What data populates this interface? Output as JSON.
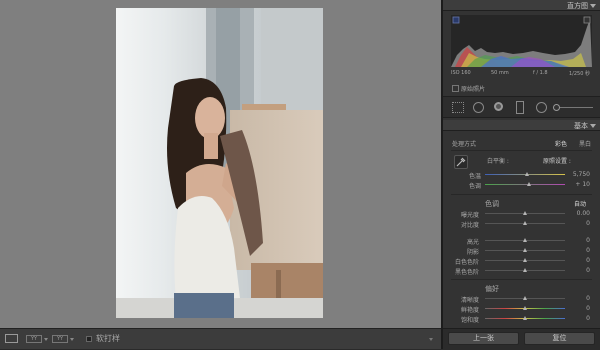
{
  "histogram": {
    "title": "直方图",
    "exif": {
      "iso": "ISO 160",
      "focal": "50 mm",
      "aperture": "f / 1.8",
      "shutter": "1/250 秒"
    },
    "original_photo_label": "原始照片"
  },
  "basic": {
    "title": "基本",
    "treatment_label": "处理方式",
    "treatment_color": "彩色",
    "treatment_bw": "黑白",
    "wb_label": "白平衡 :",
    "wb_value": "原照设置 :",
    "temp": {
      "label": "色温",
      "value": "5,750",
      "level": 0.52
    },
    "tint": {
      "label": "色调",
      "value": "+ 10",
      "level": 0.55
    },
    "tone_title": "色调",
    "auto_label": "自动",
    "exposure": {
      "label": "曝光度",
      "value": "0.00",
      "level": 0.5
    },
    "contrast": {
      "label": "对比度",
      "value": "0",
      "level": 0.5
    },
    "highlights": {
      "label": "高光",
      "value": "0",
      "level": 0.5
    },
    "shadows": {
      "label": "阴影",
      "value": "0",
      "level": 0.5
    },
    "whites": {
      "label": "白色色阶",
      "value": "0",
      "level": 0.5
    },
    "blacks": {
      "label": "黑色色阶",
      "value": "0",
      "level": 0.5
    },
    "presence_title": "偏好",
    "clarity": {
      "label": "清晰度",
      "value": "0",
      "level": 0.5
    },
    "vibrance": {
      "label": "鲜艳度",
      "value": "0",
      "level": 0.5
    },
    "saturation": {
      "label": "饱和度",
      "value": "0",
      "level": 0.5
    }
  },
  "footer": {
    "previous": "上一张",
    "reset": "复位"
  },
  "toolbar": {
    "softproof": "软打样"
  }
}
